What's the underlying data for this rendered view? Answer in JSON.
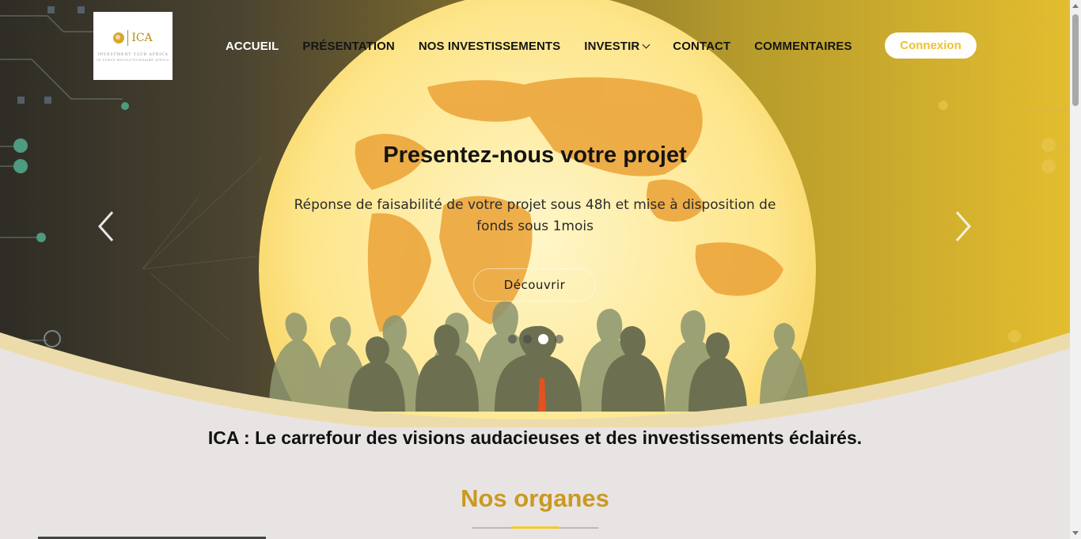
{
  "logo": {
    "abbr": "ICA",
    "line1": "INVESTMENT CLUB AFRICA",
    "line2": "LE FORCE REVOLUTIONNAIRE AFRICA"
  },
  "nav": {
    "items": [
      {
        "label": "ACCUEIL",
        "active": true
      },
      {
        "label": "PRÉSENTATION",
        "active": false
      },
      {
        "label": "NOS INVESTISSEMENTS",
        "active": false
      },
      {
        "label": "INVESTIR",
        "active": false,
        "dropdown": true
      },
      {
        "label": "CONTACT",
        "active": false
      },
      {
        "label": "COMMENTAIRES",
        "active": false
      }
    ],
    "login_label": "Connexion"
  },
  "hero": {
    "title": "Presentez-nous votre projet",
    "description": "Réponse de faisabilité de votre projet sous 48h et mise à disposition de fonds sous 1mois",
    "button_label": "Découvrir",
    "prev_icon": "chevron-left-icon",
    "next_icon": "chevron-right-icon",
    "slide_count": 4,
    "active_slide": 3
  },
  "tagline": "ICA : Le carrefour des visions audacieuses et des investissements éclairés.",
  "section_title": "Nos organes",
  "colors": {
    "accent": "#f0c22a",
    "title_gold": "#c99a22",
    "page_bg": "#e9e4e4"
  }
}
